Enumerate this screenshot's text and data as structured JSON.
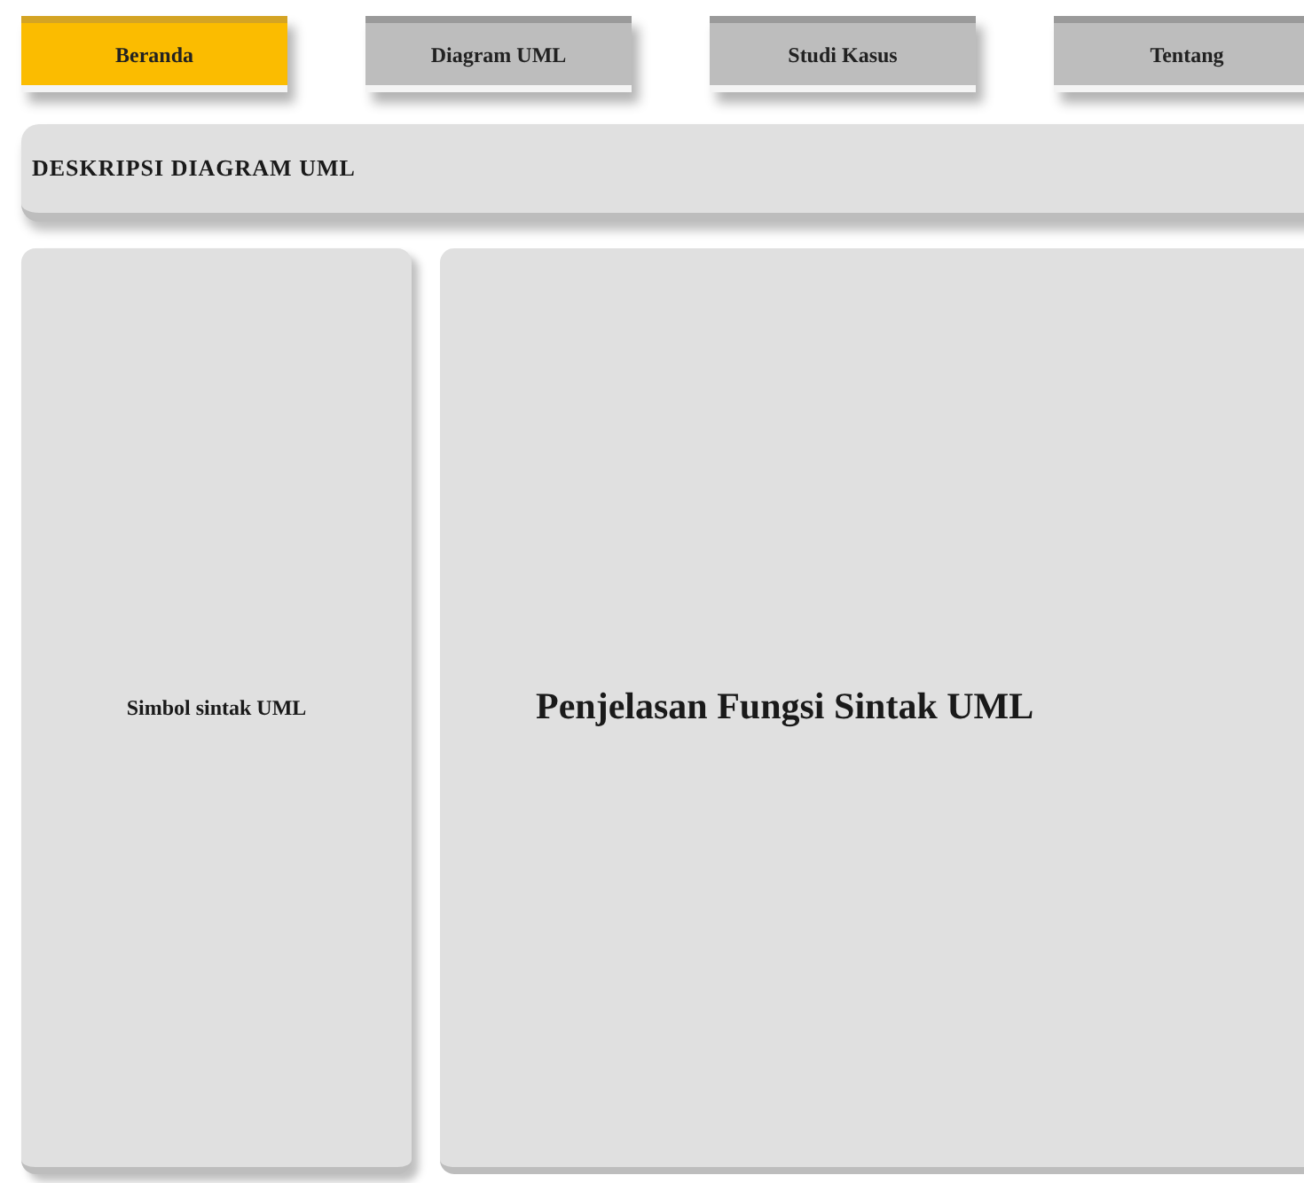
{
  "nav": [
    {
      "label": "Beranda",
      "selected": true
    },
    {
      "label": "Diagram UML",
      "selected": false
    },
    {
      "label": "Studi Kasus",
      "selected": false
    },
    {
      "label": "Tentang",
      "selected": false
    }
  ],
  "header": {
    "title": "DESKRIPSI DIAGRAM UML"
  },
  "sidebar": {
    "text": "Simbol sintak UML"
  },
  "content": {
    "text": "Penjelasan Fungsi Sintak UML"
  }
}
